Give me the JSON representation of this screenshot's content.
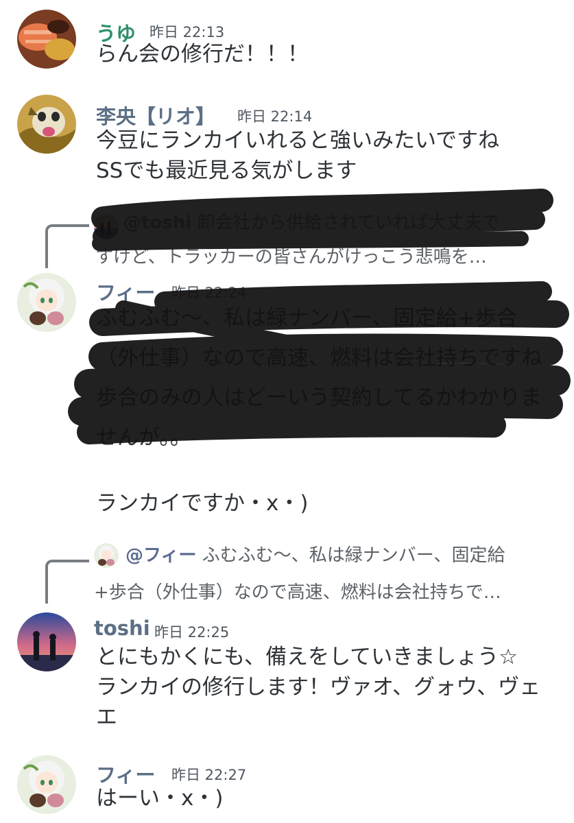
{
  "messages": [
    {
      "author": "うゆ",
      "author_color": "#2f8f68",
      "time": "昨日 22:13",
      "lines": [
        "らん会の修行だ！！！"
      ]
    },
    {
      "author": "李央【リオ】",
      "author_color": "#5b6f86",
      "time": "昨日 22:14",
      "lines": [
        "今豆にランカイいれると強いみたいですね",
        "SSでも最近見る気がします"
      ]
    },
    {
      "reply": {
        "mention": "@toshi",
        "lines": [
          " 卸会社から供給されていれば大丈夫で",
          "すけど、トラッカーの皆さんがけっこう悲鳴を…"
        ]
      },
      "author": "フィー",
      "author_color": "#5b6f86",
      "time": "昨日 22:24",
      "lines": [
        "ふむふむ〜、私は緑ナンバー、固定給+歩合",
        "（外仕事）なので高速、燃料は会社持ちですね",
        "歩合のみの人はどーいう契約してるかわかりま",
        "せんが。。",
        "",
        "ランカイですか・x・)"
      ]
    },
    {
      "reply": {
        "mention": "@フィー",
        "lines": [
          " ふむふむ〜、私は緑ナンバー、固定給",
          "+歩合（外仕事）なので高速、燃料は会社持ちで…"
        ]
      },
      "author": "toshi",
      "author_color": "#5b6f86",
      "time": "昨日 22:25",
      "lines": [
        "とにもかくにも、備えをしていきましょう☆",
        "ランカイの修行します！ヴァオ、グォウ、ヴェ",
        "エ"
      ]
    },
    {
      "author": "フィー",
      "author_color": "#5b6f86",
      "time": "昨日 22:27",
      "lines": [
        "はーい・x・)"
      ]
    }
  ]
}
